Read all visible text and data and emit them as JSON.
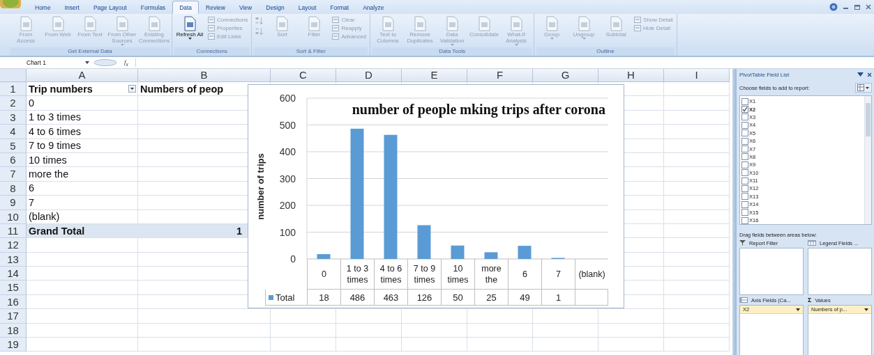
{
  "ribbon_tabs": [
    {
      "label": "Home",
      "selected": false
    },
    {
      "label": "Insert",
      "selected": false
    },
    {
      "label": "Page Layout",
      "selected": false
    },
    {
      "label": "Formulas",
      "selected": false
    },
    {
      "label": "Data",
      "selected": true
    },
    {
      "label": "Review",
      "selected": false
    },
    {
      "label": "View",
      "selected": false
    },
    {
      "label": "Design",
      "selected": false
    },
    {
      "label": "Layout",
      "selected": false
    },
    {
      "label": "Format",
      "selected": false
    },
    {
      "label": "Analyze",
      "selected": false
    }
  ],
  "ribbon_groups": [
    {
      "title": "Get External Data",
      "buttons": [
        {
          "label": "From Access",
          "kind": "large",
          "disabled": true
        },
        {
          "label": "From Web",
          "kind": "large",
          "disabled": true
        },
        {
          "label": "From Text",
          "kind": "large",
          "disabled": true
        },
        {
          "label": "From Other Sources",
          "kind": "large",
          "disabled": true,
          "dropdown": true
        },
        {
          "label": "Existing Connections",
          "kind": "large",
          "disabled": true
        }
      ]
    },
    {
      "title": "Connections",
      "buttons": [
        {
          "label": "Refresh All",
          "kind": "large",
          "disabled": false,
          "dropdown": true
        },
        {
          "label": "Connections",
          "kind": "small",
          "disabled": true
        },
        {
          "label": "Properties",
          "kind": "small",
          "disabled": true
        },
        {
          "label": "Edit Links",
          "kind": "small",
          "disabled": true
        }
      ]
    },
    {
      "title": "Sort & Filter",
      "buttons": [
        {
          "kind": "sort_ascending",
          "disabled": true
        },
        {
          "kind": "sort_descending",
          "disabled": true
        },
        {
          "label": "Sort",
          "kind": "large",
          "disabled": true
        },
        {
          "label": "Filter",
          "kind": "large",
          "disabled": true
        },
        {
          "label": "Clear",
          "kind": "small",
          "disabled": true
        },
        {
          "label": "Reapply",
          "kind": "small",
          "disabled": true
        },
        {
          "label": "Advanced",
          "kind": "small",
          "disabled": true
        }
      ]
    },
    {
      "title": "Data Tools",
      "buttons": [
        {
          "label": "Text to Columns",
          "kind": "large",
          "disabled": true
        },
        {
          "label": "Remove Duplicates",
          "kind": "large",
          "disabled": true
        },
        {
          "label": "Data Validation",
          "kind": "large",
          "disabled": true,
          "dropdown": true
        },
        {
          "label": "Consolidate",
          "kind": "large",
          "disabled": true
        },
        {
          "label": "What-If Analysis",
          "kind": "large",
          "disabled": true,
          "dropdown": true
        }
      ]
    },
    {
      "title": "Outline",
      "buttons": [
        {
          "label": "Group",
          "kind": "large",
          "disabled": true,
          "dropdown": true
        },
        {
          "label": "Ungroup",
          "kind": "large",
          "disabled": true,
          "dropdown": true
        },
        {
          "label": "Subtotal",
          "kind": "large",
          "disabled": true
        },
        {
          "label": "Show Detail",
          "kind": "small",
          "disabled": true
        },
        {
          "label": "Hide Detail",
          "kind": "small",
          "disabled": true
        }
      ]
    }
  ],
  "formula_bar": {
    "name_box": "Chart 1",
    "function_label": "f$_{x}$"
  },
  "sheet": {
    "columns": [
      "A",
      "B",
      "C",
      "D",
      "E",
      "F",
      "G",
      "H",
      "I"
    ],
    "rows": [
      {
        "number": "1",
        "kind": "header",
        "cells": [
          {
            "text": "Trip numbers",
            "filter": true
          },
          {
            "text": "Numbers of peop"
          }
        ]
      },
      {
        "number": "2",
        "kind": "item",
        "cells": [
          {
            "text": "0"
          }
        ]
      },
      {
        "number": "3",
        "kind": "item",
        "cells": [
          {
            "text": "1 to 3 times"
          }
        ]
      },
      {
        "number": "4",
        "kind": "item",
        "cells": [
          {
            "text": "4 to 6 times"
          }
        ]
      },
      {
        "number": "5",
        "kind": "item",
        "cells": [
          {
            "text": "7 to 9 times"
          }
        ]
      },
      {
        "number": "6",
        "kind": "item",
        "cells": [
          {
            "text": "10 times"
          }
        ]
      },
      {
        "number": "7",
        "kind": "item",
        "cells": [
          {
            "text": "more the"
          }
        ]
      },
      {
        "number": "8",
        "kind": "item",
        "cells": [
          {
            "text": "6"
          }
        ]
      },
      {
        "number": "9",
        "kind": "item",
        "cells": [
          {
            "text": "7"
          }
        ]
      },
      {
        "number": "10",
        "kind": "item",
        "cells": [
          {
            "text": "(blank)"
          }
        ]
      },
      {
        "number": "11",
        "kind": "total",
        "cells": [
          {
            "text": "Grand Total"
          },
          {
            "text": "1"
          }
        ]
      },
      {
        "number": "12",
        "kind": "empty"
      },
      {
        "number": "13",
        "kind": "empty"
      },
      {
        "number": "14",
        "kind": "empty"
      },
      {
        "number": "15",
        "kind": "empty"
      },
      {
        "number": "16",
        "kind": "empty"
      },
      {
        "number": "17",
        "kind": "empty"
      },
      {
        "number": "18",
        "kind": "empty"
      },
      {
        "number": "19",
        "kind": "empty"
      }
    ]
  },
  "chart": {
    "chart_data": {
      "type": "bar",
      "title": "number of people mking trips after corona",
      "ylabel": "number of trips",
      "categories": [
        "0",
        "1 to 3 times",
        "4 to 6 times",
        "7 to 9 times",
        "10 times",
        "more the",
        "6",
        "7",
        "(blank)"
      ],
      "series": [
        {
          "name": "Total",
          "color": "#5b9bd5",
          "values": [
            18,
            486,
            463,
            126,
            50,
            25,
            49,
            1,
            null
          ]
        }
      ],
      "ylim": [
        0,
        600
      ],
      "yticks": [
        0,
        100,
        200,
        300,
        400,
        500,
        600
      ],
      "grid": true,
      "value_labels": [
        "18",
        "486",
        "463",
        "126",
        "50",
        "25",
        "49",
        "1",
        null
      ]
    }
  },
  "field_list": {
    "title": "PivotTable Field List",
    "choose_label": "Choose fields to add to report:",
    "fields": [
      {
        "name": "X1",
        "checked": false
      },
      {
        "name": "X2",
        "checked": true
      },
      {
        "name": "X3",
        "checked": false
      },
      {
        "name": "X4",
        "checked": false
      },
      {
        "name": "X5",
        "checked": false
      },
      {
        "name": "X6",
        "checked": false
      },
      {
        "name": "X7",
        "checked": false
      },
      {
        "name": "X8",
        "checked": false
      },
      {
        "name": "X9",
        "checked": false
      },
      {
        "name": "X10",
        "checked": false
      },
      {
        "name": "X11",
        "checked": false
      },
      {
        "name": "X12",
        "checked": false
      },
      {
        "name": "X13",
        "checked": false
      },
      {
        "name": "X14",
        "checked": false
      },
      {
        "name": "X15",
        "checked": false
      },
      {
        "name": "X16",
        "checked": false
      }
    ],
    "drag_label": "Drag fields between areas below:",
    "areas": [
      {
        "kind": "filter",
        "title": "Report Filter"
      },
      {
        "kind": "legend",
        "title": "Legend Fields ..."
      },
      {
        "kind": "axis",
        "title": "Axis Fields (Ca...",
        "items": [
          "X2"
        ]
      },
      {
        "kind": "values",
        "symbol": "Σ",
        "title": "Values",
        "items": [
          "Numbers of p..."
        ]
      }
    ]
  }
}
